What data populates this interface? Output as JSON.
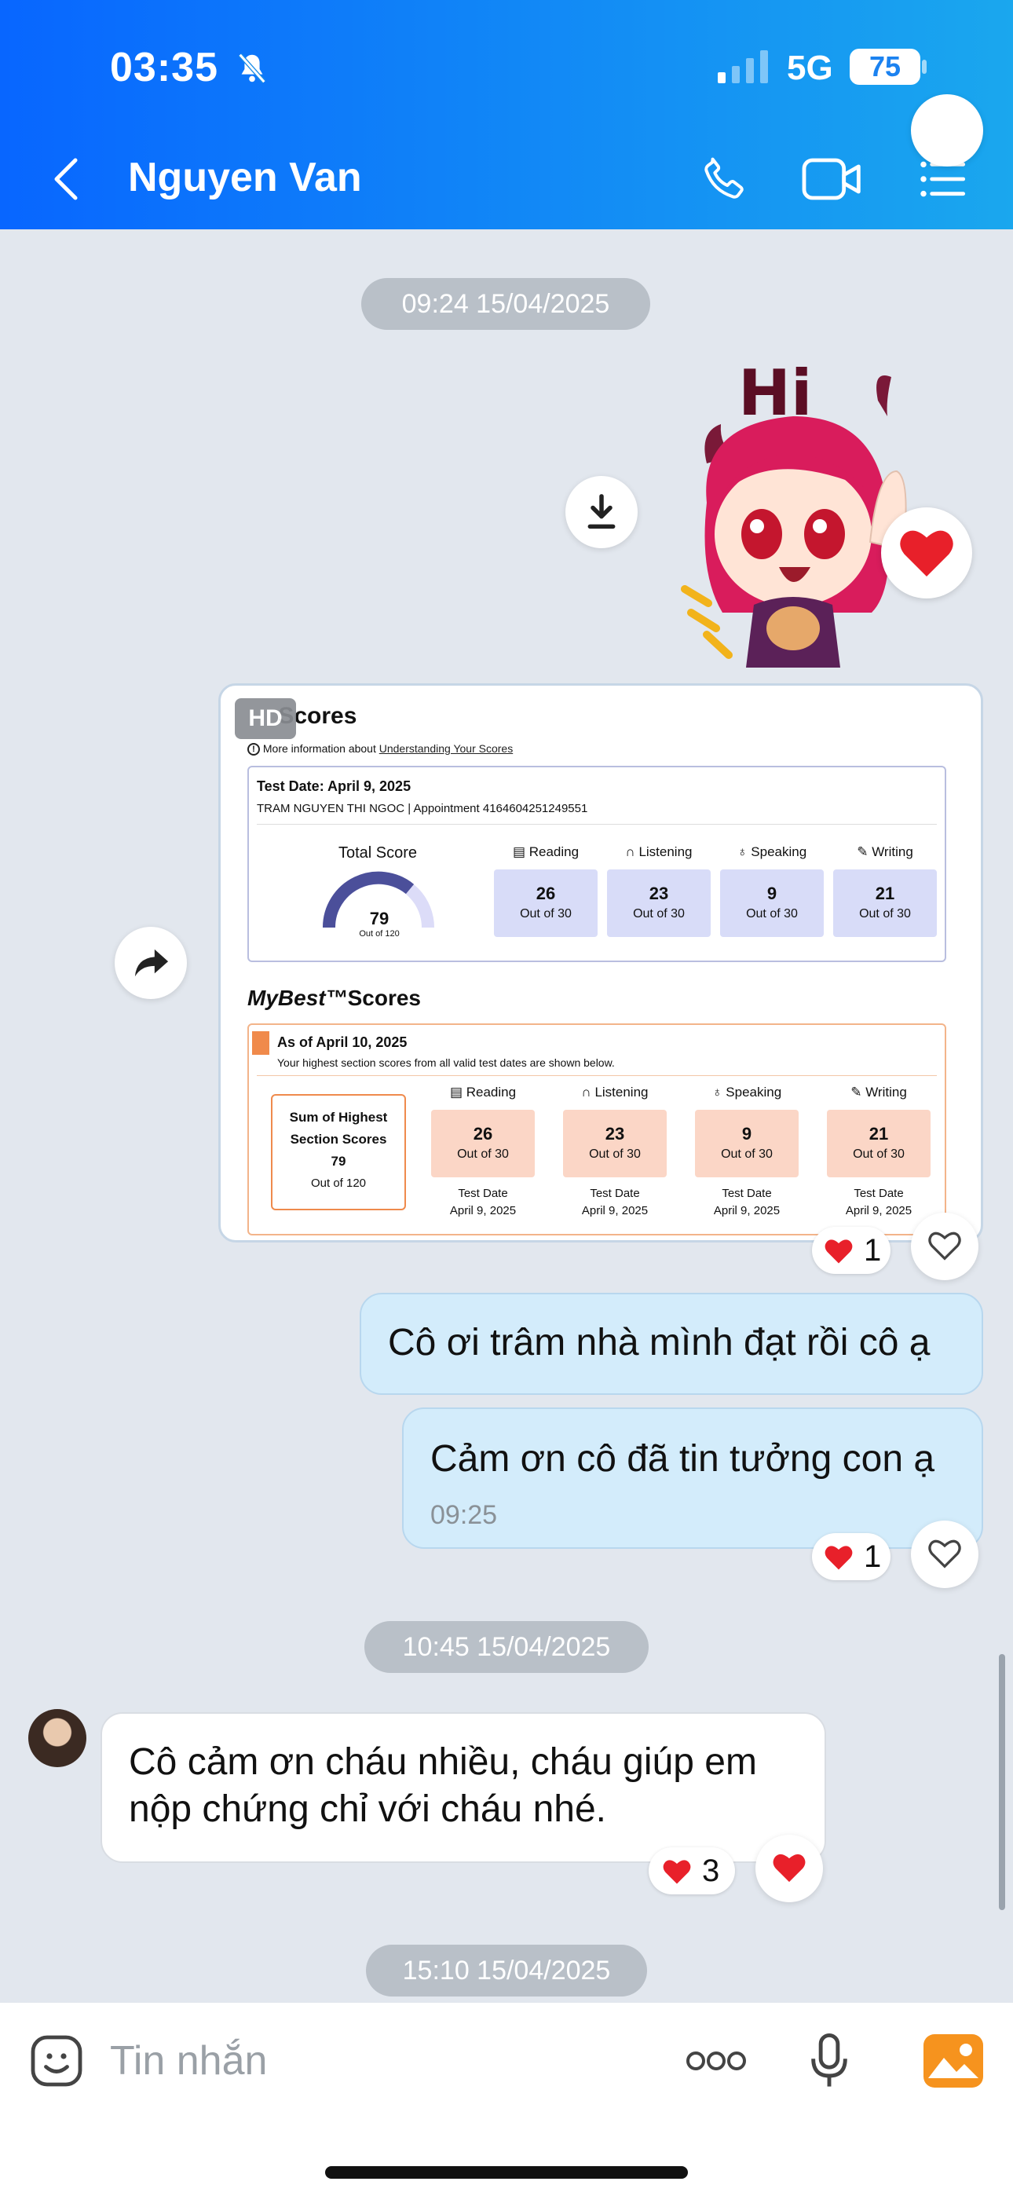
{
  "status": {
    "time": "03:35",
    "network": "5G",
    "battery": "75"
  },
  "header": {
    "contact_name": "Nguyen Van"
  },
  "timestamps": [
    "09:24 15/04/2025",
    "10:45 15/04/2025",
    "15:10 15/04/2025"
  ],
  "sticker": {
    "text": "Hi"
  },
  "image_message": {
    "hd_badge": "HD",
    "title": "Scores",
    "info_text": "More information about",
    "info_link": "Understanding Your Scores",
    "test_date": "Test Date: April 9, 2025",
    "name_line": "TRAM NGUYEN THI NGOC  |  Appointment 4164604251249551",
    "total_label": "Total Score",
    "total_value": "79",
    "total_out_of": "Out of 120",
    "sections": [
      {
        "name": "Reading",
        "value": "26",
        "out_of": "Out of 30"
      },
      {
        "name": "Listening",
        "value": "23",
        "out_of": "Out of 30"
      },
      {
        "name": "Speaking",
        "value": "9",
        "out_of": "Out of 30"
      },
      {
        "name": "Writing",
        "value": "21",
        "out_of": "Out of 30"
      }
    ],
    "mybest_title_a": "MyBest™",
    "mybest_title_b": "Scores",
    "as_of": "As of April 10, 2025",
    "mybest_desc": "Your highest section scores from all valid test dates are shown below.",
    "sum_label_1": "Sum of Highest",
    "sum_label_2": "Section Scores",
    "sum_value": "79",
    "sum_out_of": "Out of 120",
    "mybest_date_label": "Test Date",
    "mybest_date": "April 9, 2025"
  },
  "messages": {
    "out_1": "Cô ơi trâm nhà mình đạt rồi cô ạ",
    "out_2": "Cảm ơn cô đã tin tưởng con ạ",
    "out_2_time": "09:25",
    "in_1_line1": "Cô cảm ơn cháu nhiều, cháu giúp em",
    "in_1_line2": "nộp chứng chỉ với cháu nhé."
  },
  "reactions": {
    "image": "1",
    "out_2": "1",
    "in_1": "3"
  },
  "input": {
    "placeholder": "Tin nhắn"
  },
  "colors": {
    "header_start": "#0866ff",
    "header_end": "#1aa7ee",
    "out_bubble": "#d3ecfb",
    "heart": "#e8202a",
    "accent_orange": "#f08a4b"
  }
}
